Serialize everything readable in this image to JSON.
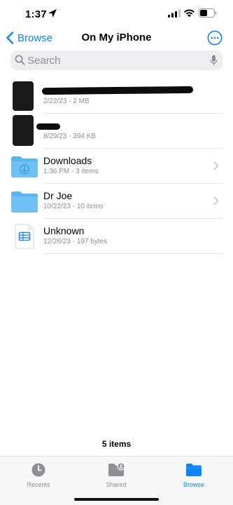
{
  "status_bar": {
    "time": "1:37",
    "icons": [
      "location-arrow-icon",
      "cellular-signal-icon",
      "wifi-icon",
      "battery-icon"
    ]
  },
  "nav": {
    "back_label": "Browse",
    "title": "On My iPhone",
    "more_icon": "ellipsis-circle-icon"
  },
  "search": {
    "placeholder": "Search",
    "value": ""
  },
  "files": [
    {
      "name": "",
      "meta": "2/22/23 - 2 MB",
      "icon": "redacted-thumbnail",
      "redacted": true
    },
    {
      "name": "",
      "meta": "8/29/23 - 394 KB",
      "icon": "redacted-thumbnail",
      "redacted": true
    },
    {
      "name": "Downloads",
      "meta": "1:36 PM - 3 items",
      "icon": "folder-download-icon",
      "chevron": true
    },
    {
      "name": "Dr Joe",
      "meta": "10/22/23 - 10 items",
      "icon": "folder-icon",
      "chevron": true
    },
    {
      "name": "Unknown",
      "meta": "12/26/23 - 197 bytes",
      "icon": "spreadsheet-file-icon"
    }
  ],
  "footer": {
    "items_count": "5 items"
  },
  "tabbar": {
    "tabs": [
      {
        "label": "Recents",
        "icon": "clock-icon",
        "active": false
      },
      {
        "label": "Shared",
        "icon": "shared-folder-icon",
        "active": false
      },
      {
        "label": "Browse",
        "icon": "folder-icon",
        "active": true
      }
    ]
  },
  "colors": {
    "accent": "#0a84ff",
    "folder": "#5ab4f0",
    "secondary_text": "#8e8e93"
  }
}
